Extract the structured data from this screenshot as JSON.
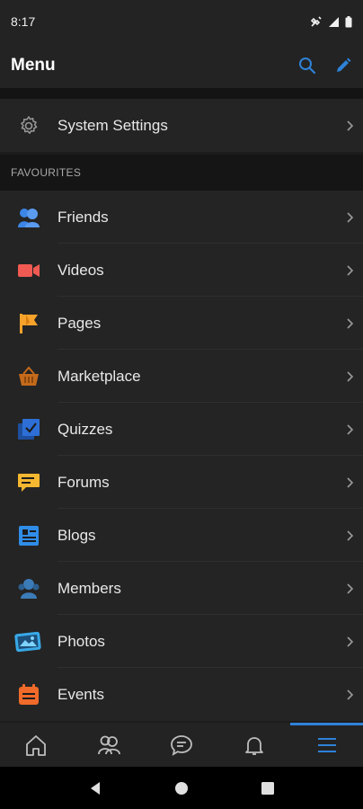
{
  "status_bar": {
    "time": "8:17"
  },
  "header": {
    "title": "Menu"
  },
  "settings": {
    "label": "System Settings"
  },
  "section": {
    "title": "FAVOURITES"
  },
  "menu_items": [
    {
      "label": "Friends",
      "icon": "friends-icon",
      "color": "#3b86e6"
    },
    {
      "label": "Videos",
      "icon": "video-icon",
      "color": "#f05a53"
    },
    {
      "label": "Pages",
      "icon": "flag-icon",
      "color": "#f6a22b"
    },
    {
      "label": "Marketplace",
      "icon": "basket-icon",
      "color": "#c46a1b"
    },
    {
      "label": "Quizzes",
      "icon": "quiz-icon",
      "color": "#2d6fd6"
    },
    {
      "label": "Forums",
      "icon": "forum-icon",
      "color": "#f5b730"
    },
    {
      "label": "Blogs",
      "icon": "blog-icon",
      "color": "#2f8de8"
    },
    {
      "label": "Members",
      "icon": "members-icon",
      "color": "#3b7cb8"
    },
    {
      "label": "Photos",
      "icon": "photos-icon",
      "color": "#38a9e8"
    },
    {
      "label": "Events",
      "icon": "events-icon",
      "color": "#f06a2a"
    }
  ],
  "bottom_nav": [
    {
      "name": "home-icon"
    },
    {
      "name": "friends-icon"
    },
    {
      "name": "chat-icon"
    },
    {
      "name": "bell-icon"
    },
    {
      "name": "menu-icon",
      "active": true
    }
  ],
  "colors": {
    "accent": "#2e82d8",
    "background": "#1c1c1c",
    "row": "#242424"
  }
}
